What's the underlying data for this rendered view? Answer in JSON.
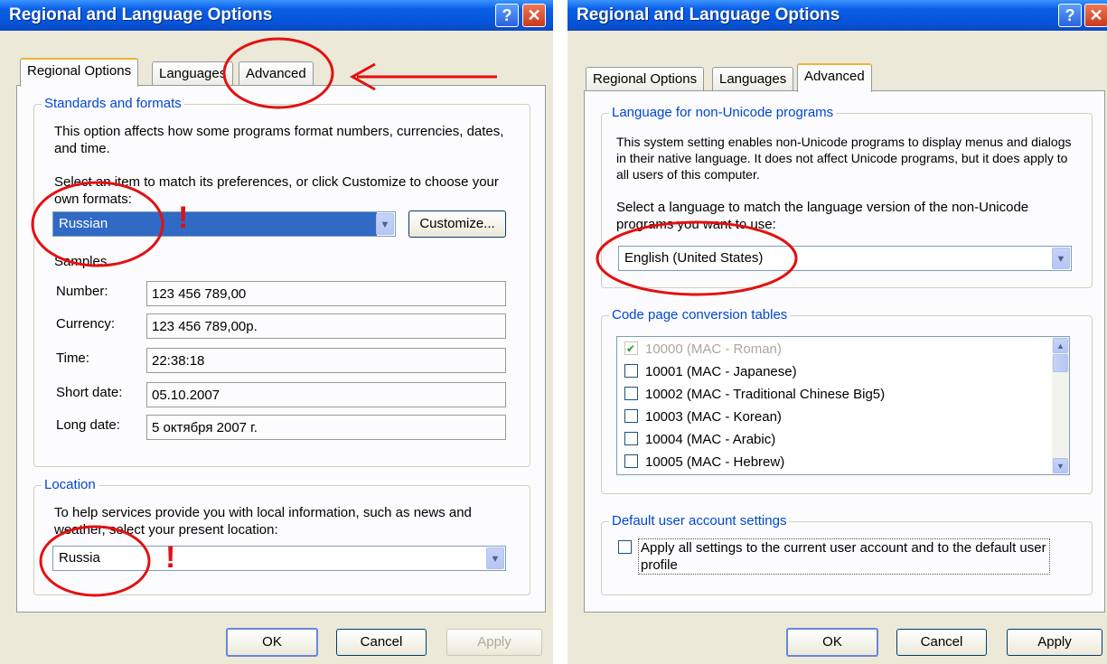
{
  "left_window": {
    "title": "Regional and Language Options",
    "tabs": [
      "Regional Options",
      "Languages",
      "Advanced"
    ],
    "standards": {
      "legend": "Standards and formats",
      "description": "This option affects how some programs format numbers, currencies, dates, and time.",
      "select_prompt": "Select an item to match its preferences, or click Customize to choose your own formats:",
      "format_value": "Russian",
      "customize_label": "Customize...",
      "samples_label": "Samples",
      "samples": [
        {
          "label": "Number:",
          "value": "123 456 789,00"
        },
        {
          "label": "Currency:",
          "value": "123 456 789,00р."
        },
        {
          "label": "Time:",
          "value": "22:38:18"
        },
        {
          "label": "Short date:",
          "value": "05.10.2007"
        },
        {
          "label": "Long date:",
          "value": "5 октября 2007 г."
        }
      ]
    },
    "location": {
      "legend": "Location",
      "description": "To help services provide you with local information, such as news and weather, select your present location:",
      "value": "Russia"
    },
    "buttons": {
      "ok": "OK",
      "cancel": "Cancel",
      "apply": "Apply"
    }
  },
  "right_window": {
    "title": "Regional and Language Options",
    "tabs": [
      "Regional Options",
      "Languages",
      "Advanced"
    ],
    "non_unicode": {
      "legend": "Language for non-Unicode programs",
      "description": "This system setting enables non-Unicode programs to display menus and dialogs in their native language. It does not affect Unicode programs, but it does apply to all users of this computer.",
      "select_prompt": "Select a language to match the language version of the non-Unicode programs you want to use:",
      "value": "English (United States)"
    },
    "code_pages": {
      "legend": "Code page conversion tables",
      "items": [
        {
          "label": "10000 (MAC - Roman)",
          "checked": true,
          "disabled": true
        },
        {
          "label": "10001 (MAC - Japanese)",
          "checked": false,
          "disabled": false
        },
        {
          "label": "10002 (MAC - Traditional Chinese Big5)",
          "checked": false,
          "disabled": false
        },
        {
          "label": "10003 (MAC - Korean)",
          "checked": false,
          "disabled": false
        },
        {
          "label": "10004 (MAC - Arabic)",
          "checked": false,
          "disabled": false
        },
        {
          "label": "10005 (MAC - Hebrew)",
          "checked": false,
          "disabled": false
        }
      ]
    },
    "default_user": {
      "legend": "Default user account settings",
      "checkbox_label": "Apply all settings to the current user account and to the default user profile"
    },
    "buttons": {
      "ok": "OK",
      "cancel": "Cancel",
      "apply": "Apply"
    }
  },
  "annotations": {
    "exclamation": "!",
    "color": "#e41010"
  },
  "colors": {
    "title_bar": "#0654d9",
    "dialog_bg": "#ece9d8",
    "group_legend": "#0046d5",
    "selection": "#316ac5"
  }
}
